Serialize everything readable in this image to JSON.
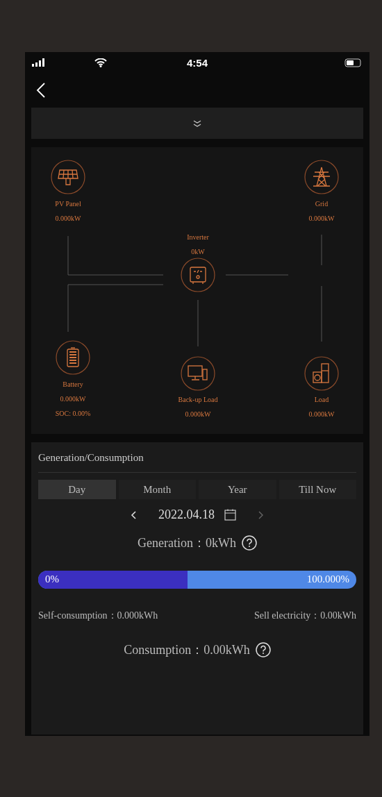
{
  "status_bar": {
    "time": "4:54"
  },
  "flow_diagram": {
    "nodes": [
      {
        "label": "PV Panel",
        "values": [
          "0.000kW"
        ]
      },
      {
        "label": "Grid",
        "values": [
          "0.000kW"
        ]
      },
      {
        "label": "Inverter",
        "values": [
          "0kW"
        ]
      },
      {
        "label": "Battery",
        "values": [
          "0.000kW",
          "SOC: 0.00%"
        ]
      },
      {
        "label": "Back-up Load",
        "values": [
          "0.000kW"
        ]
      },
      {
        "label": "Load",
        "values": [
          "0.000kW"
        ]
      }
    ]
  },
  "generation_consumption": {
    "title": "Generation/Consumption",
    "tabs": [
      {
        "label": "Day",
        "selected": true
      },
      {
        "label": "Month",
        "selected": false
      },
      {
        "label": "Year",
        "selected": false
      },
      {
        "label": "Till Now",
        "selected": false
      }
    ],
    "date": "2022.04.18",
    "generation": "Generation：0kWh",
    "ratio_bar": {
      "level": 0.47,
      "left_label": "0%",
      "right_label": "100.000%"
    },
    "self_consumption": "Self-consumption：0.000kWh",
    "sell_electricity": "Sell electricity：0.00kWh",
    "consumption": "Consumption：0.00kWh"
  }
}
